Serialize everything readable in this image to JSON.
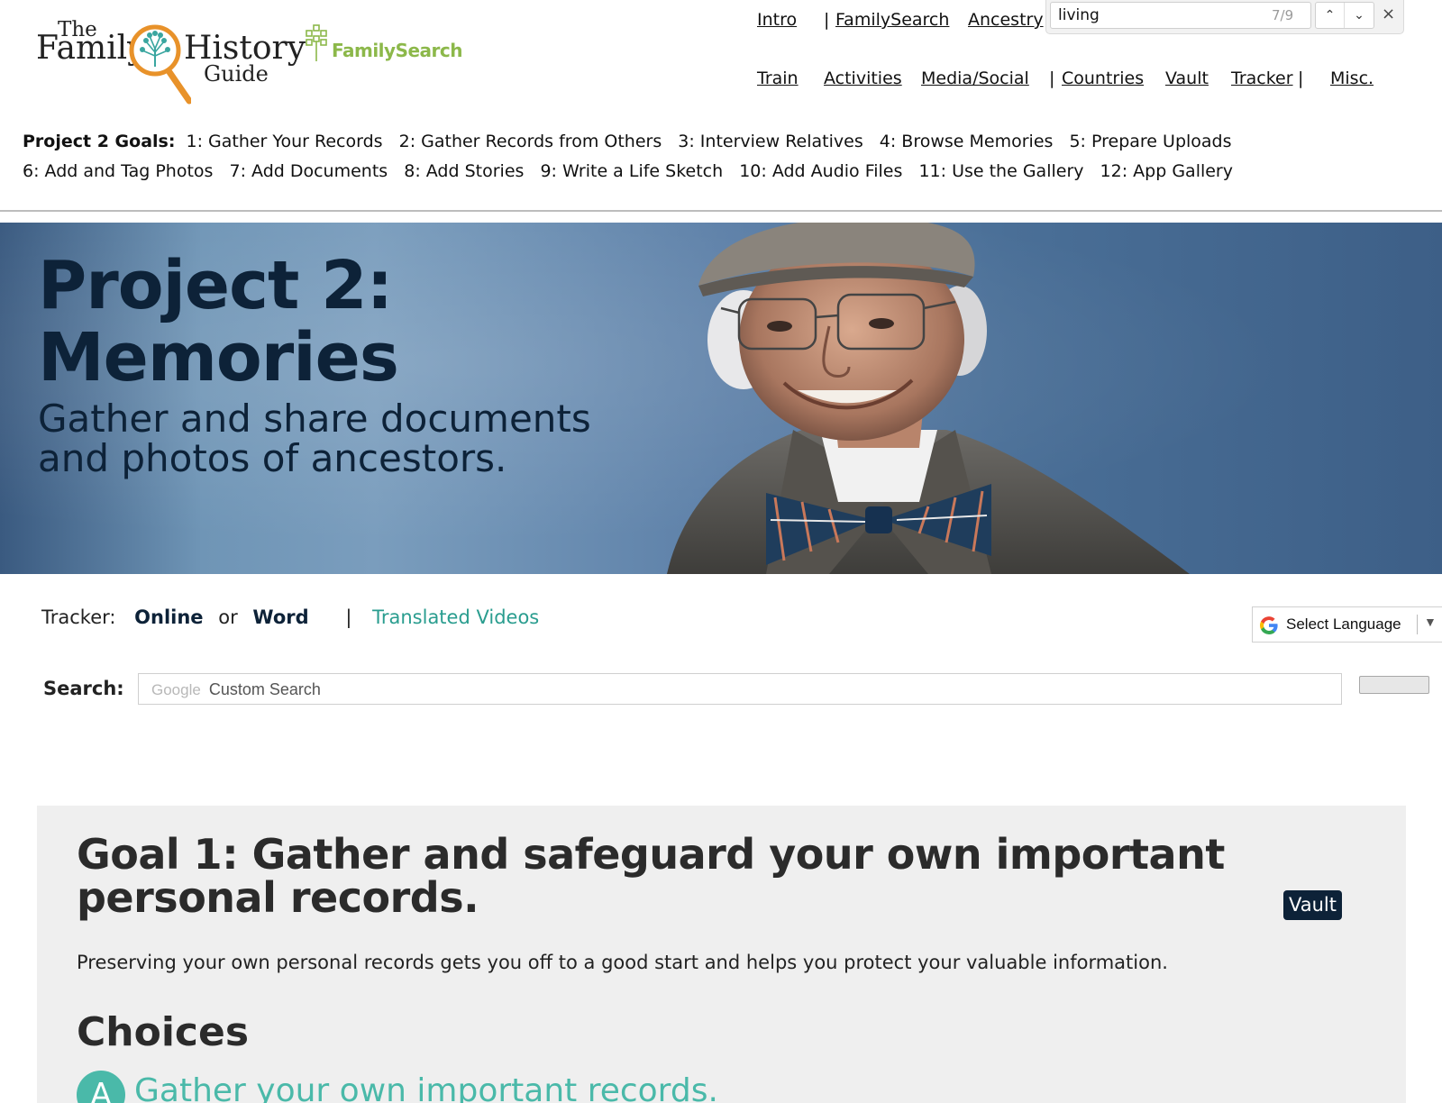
{
  "brand": {
    "fhg_logo": {
      "the": "The",
      "family": "Family",
      "history": "History",
      "guide": "Guide"
    },
    "fs_logo": "FamilySearch"
  },
  "topnav": {
    "row1": [
      "Intro",
      "FamilySearch",
      "Ancestry"
    ],
    "row1_seps": [
      "|"
    ],
    "row2": [
      "Train",
      "Activities",
      "Media/Social",
      "Countries",
      "Vault",
      "Tracker",
      "Misc."
    ],
    "row2_seps": [
      "|",
      "|"
    ]
  },
  "findbar": {
    "query": "living",
    "count": "7/9",
    "up": "⌃",
    "down": "⌄",
    "close": "×"
  },
  "goals": {
    "label": "Project 2 Goals:",
    "items": [
      "1: Gather Your Records",
      "2: Gather Records from Others",
      "3: Interview Relatives",
      "4: Browse Memories",
      "5: Prepare Uploads",
      "6: Add and Tag Photos",
      "7: Add Documents",
      "8: Add Stories",
      "9: Write a Life Sketch",
      "10: Add Audio Files",
      "11: Use the Gallery",
      "12: App Gallery"
    ]
  },
  "hero": {
    "title_line1": "Project 2:",
    "title_line2": "Memories",
    "subtitle": "Gather and share documents and photos of ancestors."
  },
  "tracker": {
    "label": "Tracker:",
    "online": "Online",
    "or": "or",
    "word": "Word",
    "pipe": "|",
    "translated": "Translated Videos"
  },
  "language": {
    "label": "Select Language",
    "arrow": "▼"
  },
  "search": {
    "label": "Search:",
    "google": "Google",
    "placeholder": "Custom Search"
  },
  "goal1": {
    "title": "Goal 1: Gather and safeguard your own important personal records.",
    "badge": "Vault",
    "description": "Preserving your own personal records gets you off to a good start and helps you protect your valuable information.",
    "choices_heading": "Choices",
    "choice_a_letter": "A",
    "choice_a_text": "Gather your own important records."
  },
  "colors": {
    "navy": "#0d2238",
    "teal": "#2a9d8f",
    "choice_teal": "#4ab9a9",
    "panel": "#efefef",
    "fs_green": "#8cb84a",
    "fhg_orange": "#e8922a"
  }
}
